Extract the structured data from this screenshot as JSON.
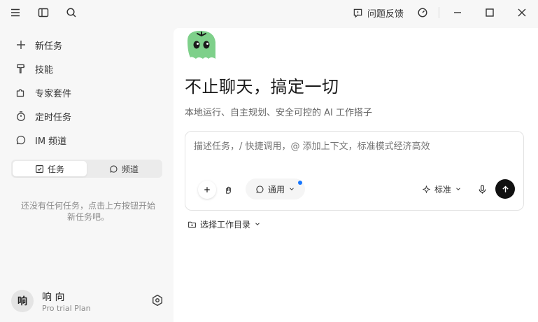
{
  "titlebar": {
    "feedback_label": "问题反馈"
  },
  "sidebar": {
    "items": [
      {
        "label": "新任务",
        "icon": "plus-icon"
      },
      {
        "label": "技能",
        "icon": "brush-icon"
      },
      {
        "label": "专家套件",
        "icon": "puzzle-icon"
      },
      {
        "label": "定时任务",
        "icon": "timer-icon"
      },
      {
        "label": "IM 频道",
        "icon": "chat-icon"
      }
    ],
    "segment": {
      "tasks_label": "任务",
      "channels_label": "频道",
      "active": "任务"
    },
    "empty_text": "还没有任何任务，点击上方按钮开始新任务吧。",
    "user": {
      "avatar_text": "响",
      "name": "响 向",
      "plan": "Pro trial Plan"
    }
  },
  "main": {
    "title": "不止聊天，搞定一切",
    "subtitle": "本地运行、自主规划、安全可控的 AI 工作搭子",
    "composer": {
      "placeholder": "描述任务，/ 快捷调用，@ 添加上下文，标准模式经济高效",
      "mode_label": "通用",
      "level_label": "标准"
    },
    "workdir_label": "选择工作目录"
  },
  "colors": {
    "accent_dot": "#1677ff",
    "send_button": "#111111",
    "mascot_green": "#7ed08a"
  }
}
